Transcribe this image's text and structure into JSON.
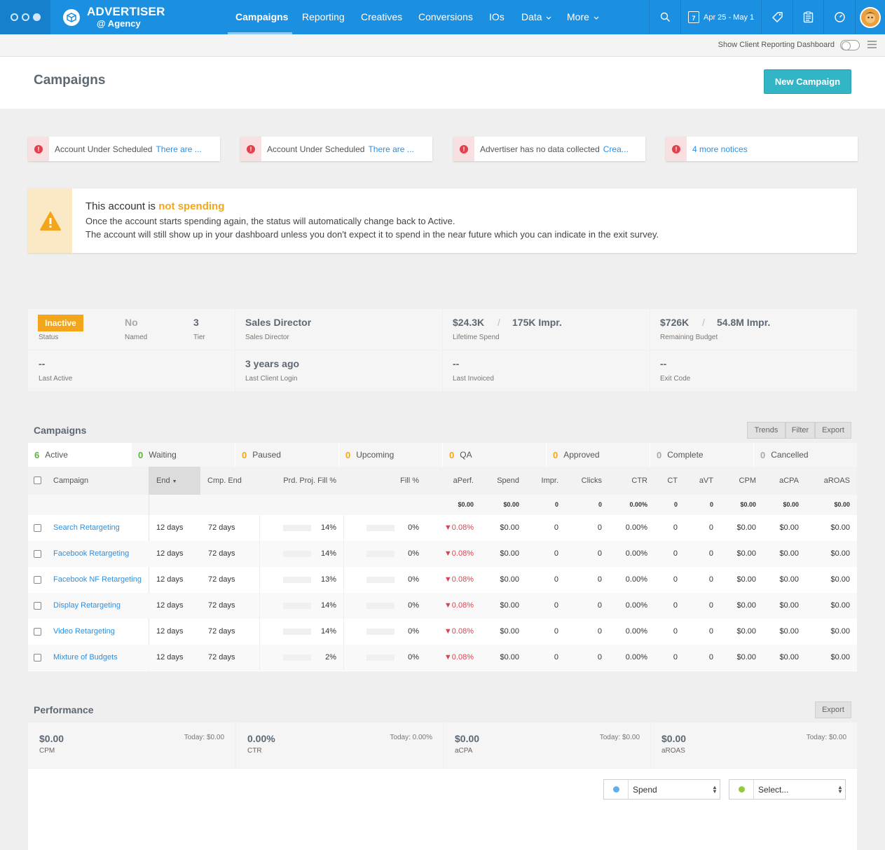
{
  "brand": {
    "name": "ADVERTISER",
    "sub": "@ Agency"
  },
  "nav": {
    "items": [
      {
        "label": "Campaigns"
      },
      {
        "label": "Reporting"
      },
      {
        "label": "Creatives"
      },
      {
        "label": "Conversions"
      },
      {
        "label": "IOs"
      },
      {
        "label": "Data"
      },
      {
        "label": "More"
      }
    ],
    "date_range": "Apr 25 - May 1",
    "calendar_day": "7"
  },
  "subbar": {
    "client_dashboard_label": "Show Client Reporting Dashboard",
    "client_dashboard_on": false
  },
  "header": {
    "title": "Campaigns",
    "new_campaign": "New Campaign"
  },
  "notices": [
    {
      "text": "Account Under Scheduled",
      "link": "There are ..."
    },
    {
      "text": "Account Under Scheduled",
      "link": "There are ..."
    },
    {
      "text": "Advertiser has no data collected",
      "link": "Crea..."
    },
    {
      "text": "",
      "link": "4 more notices"
    }
  ],
  "alert": {
    "title_prefix": "This account is",
    "title_emph": "not spending",
    "line1": "Once the account starts spending again, the status will automatically change back to Active.",
    "line2": "The account will still show up in your dashboard unless you don't expect it to spend in the near future which you can indicate in the exit survey."
  },
  "summary": {
    "status": {
      "value": "Inactive",
      "label": "Status"
    },
    "named": {
      "value": "No",
      "label": "Named"
    },
    "tier": {
      "value": "3",
      "label": "Tier"
    },
    "role": {
      "value": "Sales Director",
      "label": "Sales Director"
    },
    "lifetime": {
      "spend": "$24.3K",
      "impr": "175K Impr.",
      "label": "Lifetime Spend"
    },
    "remaining": {
      "spend": "$726K",
      "impr": "54.8M Impr.",
      "label": "Remaining Budget"
    },
    "last_active": {
      "value": "--",
      "label": "Last Active"
    },
    "last_login": {
      "value": "3 years ago",
      "label": "Last Client Login"
    },
    "last_invoiced": {
      "value": "--",
      "label": "Last Invoiced"
    },
    "exit_code": {
      "value": "--",
      "label": "Exit Code"
    },
    "separator": "/"
  },
  "campaigns": {
    "title": "Campaigns",
    "buttons": {
      "trends": "Trends",
      "filter": "Filter",
      "export": "Export"
    },
    "tabs": [
      {
        "count": "6",
        "label": "Active"
      },
      {
        "count": "0",
        "label": "Waiting"
      },
      {
        "count": "0",
        "label": "Paused"
      },
      {
        "count": "0",
        "label": "Upcoming"
      },
      {
        "count": "0",
        "label": "QA"
      },
      {
        "count": "0",
        "label": "Approved"
      },
      {
        "count": "0",
        "label": "Complete"
      },
      {
        "count": "0",
        "label": "Cancelled"
      }
    ],
    "columns": [
      "Campaign",
      "End",
      "Cmp. End",
      "Prd. Proj. Fill %",
      "Fill %",
      "aPerf.",
      "Spend",
      "Impr.",
      "Clicks",
      "CTR",
      "CT",
      "aVT",
      "CPM",
      "aCPA",
      "aROAS"
    ],
    "totals": {
      "aperf": "$0.00",
      "spend": "$0.00",
      "impr": "0",
      "clicks": "0",
      "ctr": "0.00%",
      "ct": "0",
      "avt": "0",
      "cpm": "$0.00",
      "acpa": "$0.00",
      "aroas": "$0.00"
    },
    "rows": [
      {
        "name": "Search Retargeting",
        "end": "12 days",
        "cmp_end": "72 days",
        "proj_fill": "14%",
        "fill": "0%",
        "aperf": "▼0.08%",
        "spend": "$0.00",
        "impr": "0",
        "clicks": "0",
        "ctr": "0.00%",
        "ct": "0",
        "avt": "0",
        "cpm": "$0.00",
        "acpa": "$0.00",
        "aroas": "$0.00"
      },
      {
        "name": "Facebook Retargeting",
        "end": "12 days",
        "cmp_end": "72 days",
        "proj_fill": "14%",
        "fill": "0%",
        "aperf": "▼0.08%",
        "spend": "$0.00",
        "impr": "0",
        "clicks": "0",
        "ctr": "0.00%",
        "ct": "0",
        "avt": "0",
        "cpm": "$0.00",
        "acpa": "$0.00",
        "aroas": "$0.00"
      },
      {
        "name": "Facebook NF Retargeting",
        "end": "12 days",
        "cmp_end": "72 days",
        "proj_fill": "13%",
        "fill": "0%",
        "aperf": "▼0.08%",
        "spend": "$0.00",
        "impr": "0",
        "clicks": "0",
        "ctr": "0.00%",
        "ct": "0",
        "avt": "0",
        "cpm": "$0.00",
        "acpa": "$0.00",
        "aroas": "$0.00"
      },
      {
        "name": "Display Retargeting",
        "end": "12 days",
        "cmp_end": "72 days",
        "proj_fill": "14%",
        "fill": "0%",
        "aperf": "▼0.08%",
        "spend": "$0.00",
        "impr": "0",
        "clicks": "0",
        "ctr": "0.00%",
        "ct": "0",
        "avt": "0",
        "cpm": "$0.00",
        "acpa": "$0.00",
        "aroas": "$0.00"
      },
      {
        "name": "Video Retargeting",
        "end": "12 days",
        "cmp_end": "72 days",
        "proj_fill": "14%",
        "fill": "0%",
        "aperf": "▼0.08%",
        "spend": "$0.00",
        "impr": "0",
        "clicks": "0",
        "ctr": "0.00%",
        "ct": "0",
        "avt": "0",
        "cpm": "$0.00",
        "acpa": "$0.00",
        "aroas": "$0.00"
      },
      {
        "name": "Mixture of Budgets",
        "end": "12 days",
        "cmp_end": "72 days",
        "proj_fill": "2%",
        "fill": "0%",
        "aperf": "▼0.08%",
        "spend": "$0.00",
        "impr": "0",
        "clicks": "0",
        "ctr": "0.00%",
        "ct": "0",
        "avt": "0",
        "cpm": "$0.00",
        "acpa": "$0.00",
        "aroas": "$0.00"
      }
    ]
  },
  "performance": {
    "title": "Performance",
    "export": "Export",
    "metrics": [
      {
        "value": "$0.00",
        "label": "CPM",
        "today": "Today: $0.00"
      },
      {
        "value": "0.00%",
        "label": "CTR",
        "today": "Today: 0.00%"
      },
      {
        "value": "$0.00",
        "label": "aCPA",
        "today": "Today: $0.00"
      },
      {
        "value": "$0.00",
        "label": "aROAS",
        "today": "Today: $0.00"
      }
    ],
    "selects": [
      {
        "value": "Spend",
        "color": "#5fb0e8"
      },
      {
        "value": "Select...",
        "color": "#93c93a"
      }
    ]
  },
  "colors": {
    "nav": "#1b8fe0",
    "accent": "#33b5c8",
    "warning": "#f3a61b",
    "danger": "#e0414f",
    "link": "#2b8fe0"
  }
}
